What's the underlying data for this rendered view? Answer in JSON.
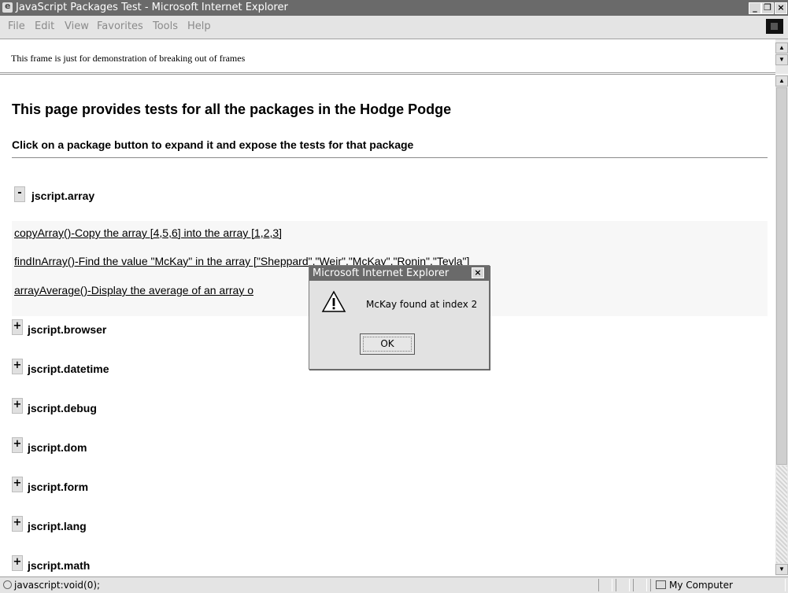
{
  "window": {
    "title": "JavaScript Packages Test - Microsoft Internet Explorer",
    "minimize": "_",
    "maximize": " ",
    "close": "×"
  },
  "menu": [
    "File",
    "Edit",
    "View",
    "Favorites",
    "Tools",
    "Help"
  ],
  "top_frame": {
    "text": "This frame is just for demonstration of breaking out of frames"
  },
  "page": {
    "heading": "This page provides tests for all the packages in the Hodge Podge",
    "subheading": "Click on a package button to expand it and expose the tests for that package",
    "expanded_package": {
      "toggle": "-",
      "name": "jscript.array",
      "tests": [
        "copyArray()-Copy the array [4,5,6] into the array [1,2,3]",
        "findInArray()-Find the value \"McKay\" in the array [\"Sheppard\",\"Weir\",\"McKay\",\"Ronin\",\"Teyla\"]",
        "arrayAverage()-Display the average of an array o"
      ]
    },
    "collapsed_toggle": "+",
    "packages": [
      "jscript.browser",
      "jscript.datetime",
      "jscript.debug",
      "jscript.dom",
      "jscript.form",
      "jscript.lang",
      "jscript.math"
    ]
  },
  "dialog": {
    "title": "Microsoft Internet Explorer",
    "close": "×",
    "icon": "warning-icon",
    "message": "McKay found at index 2",
    "ok_label": "OK"
  },
  "status": {
    "text": "javascript:void(0);",
    "zone": "My Computer"
  }
}
